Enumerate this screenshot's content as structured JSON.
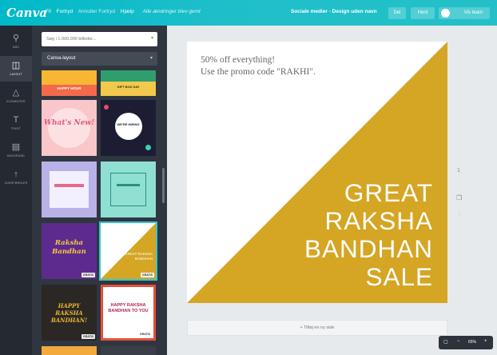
{
  "app": {
    "logo": "Canva"
  },
  "menu": {
    "file": "Fil",
    "undo": "Fortryd",
    "redo": "Annuller Fortryd",
    "help": "Hjælp",
    "saved_status": "Alle ændringer blev gemt"
  },
  "document": {
    "title": "Sociale medier - Design uden navn"
  },
  "toolbar": {
    "share": "Del",
    "download": "Hent",
    "team": "Vis team"
  },
  "rail": [
    {
      "label": "SØG",
      "icon": "search-icon"
    },
    {
      "label": "LAYOUT",
      "icon": "layout-icon"
    },
    {
      "label": "ELEMENTER",
      "icon": "elements-icon"
    },
    {
      "label": "TEKST",
      "icon": "text-icon"
    },
    {
      "label": "BAGGRUND",
      "icon": "background-icon"
    },
    {
      "label": "OVERFØRSLER",
      "icon": "upload-icon"
    }
  ],
  "panel": {
    "search_placeholder": "Søg i 1.000.000 billeder...",
    "layout_select": "Canva-layout"
  },
  "templates": [
    {
      "title": "HAPPY HOUR",
      "badge": ""
    },
    {
      "title": "GIFT BOX DAY",
      "badge": ""
    },
    {
      "title": "What's New!",
      "badge": ""
    },
    {
      "title": "WE'RE HIRING",
      "badge": ""
    },
    {
      "title": "",
      "badge": ""
    },
    {
      "title": "",
      "badge": ""
    },
    {
      "title": "Raksha Bandhan",
      "badge": "GRATIS"
    },
    {
      "title": "GREAT RAKSHA BANDHAN",
      "badge": "GRATIS"
    },
    {
      "title": "HAPPY RAKSHA BANDHAN!",
      "badge": "GRATIS"
    },
    {
      "title": "HAPPY RAKSHA BANDHAN TO YOU",
      "badge": "GRATIS"
    }
  ],
  "design": {
    "promo_line1": "50% off everything!",
    "promo_line2": "Use the promo code \"RAKHI\".",
    "sale_lines": [
      "GREAT",
      "RAKSHA",
      "BANDHAN",
      "SALE"
    ],
    "triangle_color": "#d5a524"
  },
  "canvas": {
    "page_number": "1",
    "add_page": "+ Tilføj en ny side",
    "zoom": "65%"
  },
  "colors": {
    "topbar": "#00b9c8",
    "rail": "#252a32",
    "panel": "#303640"
  }
}
